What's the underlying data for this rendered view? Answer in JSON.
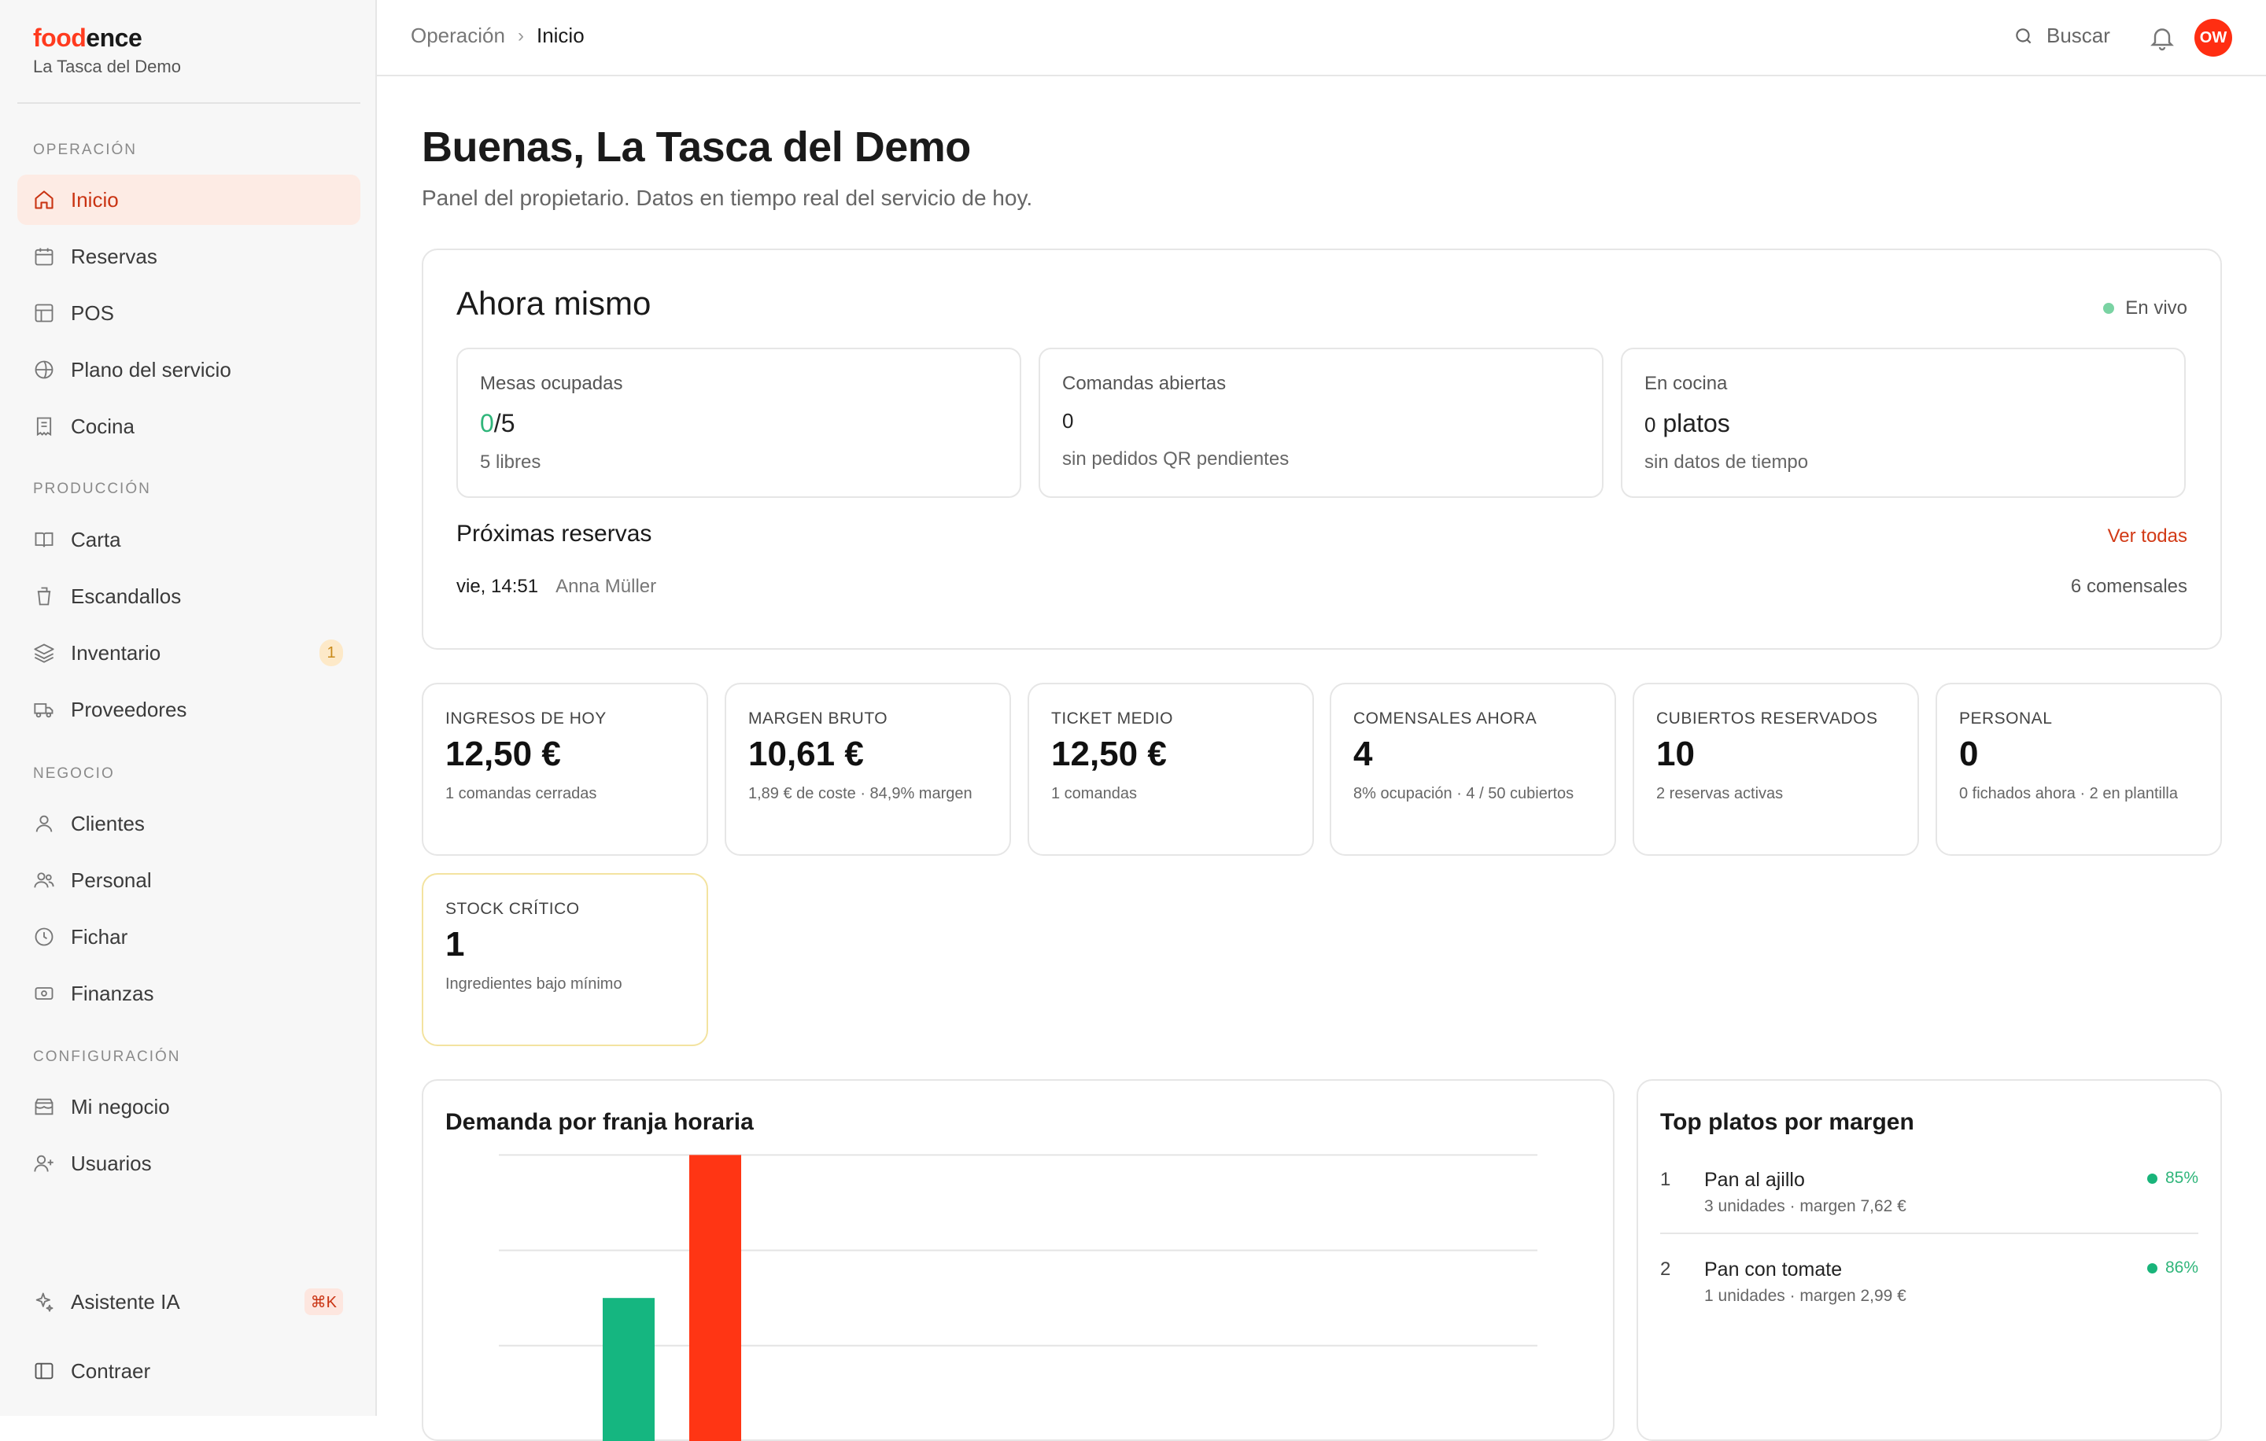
{
  "brand": {
    "logo_a": "food",
    "logo_b": "ence",
    "subtitle": "La Tasca del Demo"
  },
  "sidebar": {
    "sections": [
      {
        "label": "OPERACIÓN"
      },
      {
        "label": "PRODUCCIÓN"
      },
      {
        "label": "NEGOCIO"
      },
      {
        "label": "CONFIGURACIÓN"
      }
    ],
    "items": [
      {
        "label": "Inicio",
        "icon": "home-icon"
      },
      {
        "label": "Reservas",
        "icon": "calendar-icon"
      },
      {
        "label": "POS",
        "icon": "layout-icon"
      },
      {
        "label": "Plano del servicio",
        "icon": "globe-icon"
      },
      {
        "label": "Cocina",
        "icon": "receipt-icon"
      },
      {
        "label": "Carta",
        "icon": "book-icon"
      },
      {
        "label": "Escandallos",
        "icon": "cup-icon"
      },
      {
        "label": "Inventario",
        "icon": "layers-icon",
        "badge": "1"
      },
      {
        "label": "Proveedores",
        "icon": "truck-icon"
      },
      {
        "label": "Clientes",
        "icon": "user-icon"
      },
      {
        "label": "Personal",
        "icon": "users-icon"
      },
      {
        "label": "Fichar",
        "icon": "clock-icon"
      },
      {
        "label": "Finanzas",
        "icon": "banknote-icon"
      },
      {
        "label": "Mi negocio",
        "icon": "store-icon"
      },
      {
        "label": "Usuarios",
        "icon": "user-plus-icon"
      }
    ],
    "assistant": {
      "label": "Asistente IA",
      "shortcut": "⌘K"
    },
    "collapse": {
      "label": "Contraer"
    }
  },
  "topbar": {
    "breadcrumb_parent": "Operación",
    "breadcrumb_sep": "›",
    "breadcrumb_current": "Inicio",
    "search_label": "Buscar",
    "avatar_initials": "OW"
  },
  "header": {
    "title": "Buenas, La Tasca del Demo",
    "subtitle": "Panel del propietario. Datos en tiempo real del servicio de hoy."
  },
  "now": {
    "title": "Ahora mismo",
    "live_label": "En vivo",
    "tables": {
      "label": "Mesas ocupadas",
      "occupied": "0",
      "total": "/5",
      "sub": "5 libres"
    },
    "orders": {
      "label": "Comandas abiertas",
      "value": "0",
      "sub": "sin pedidos QR pendientes"
    },
    "kitchen": {
      "label": "En cocina",
      "value": "0",
      "unit": "platos",
      "sub": "sin datos de tiempo"
    },
    "reservations": {
      "title": "Próximas reservas",
      "link": "Ver todas",
      "rows": [
        {
          "date": "vie, 14:51",
          "name": "Anna Müller",
          "guests": "6 comensales"
        }
      ]
    }
  },
  "kpis": [
    {
      "label": "INGRESOS DE HOY",
      "value": "12,50 €",
      "sub": "1 comandas cerradas"
    },
    {
      "label": "MARGEN BRUTO",
      "value": "10,61 €",
      "sub": "1,89 € de coste · 84,9% margen"
    },
    {
      "label": "TICKET MEDIO",
      "value": "12,50 €",
      "sub": "1 comandas"
    },
    {
      "label": "COMENSALES AHORA",
      "value": "4",
      "sub": "8% ocupación · 4 / 50 cubiertos"
    },
    {
      "label": "CUBIERTOS RESERVADOS",
      "value": "10",
      "sub": "2 reservas activas"
    },
    {
      "label": "PERSONAL",
      "value": "0",
      "sub": "0 fichados ahora · 2 en plantilla"
    },
    {
      "label": "STOCK CRÍTICO",
      "value": "1",
      "sub": "Ingredientes bajo mínimo"
    }
  ],
  "demand": {
    "title": "Demanda por franja horaria"
  },
  "chart_data": {
    "type": "bar",
    "title": "Demanda por franja horaria",
    "series_count": 2,
    "bars": [
      {
        "value": 3,
        "color": "#15b680"
      },
      {
        "value": 6,
        "color": "#ff3514"
      }
    ],
    "ylim": [
      0,
      6.6
    ],
    "grid": true
  },
  "top_dishes": {
    "title": "Top platos por margen",
    "items": [
      {
        "rank": "1",
        "name": "Pan al ajillo",
        "meta": "3 unidades · margen 7,62 €",
        "pct": "85%"
      },
      {
        "rank": "2",
        "name": "Pan con tomate",
        "meta": "1 unidades · margen 2,99 €",
        "pct": "86%"
      }
    ]
  }
}
